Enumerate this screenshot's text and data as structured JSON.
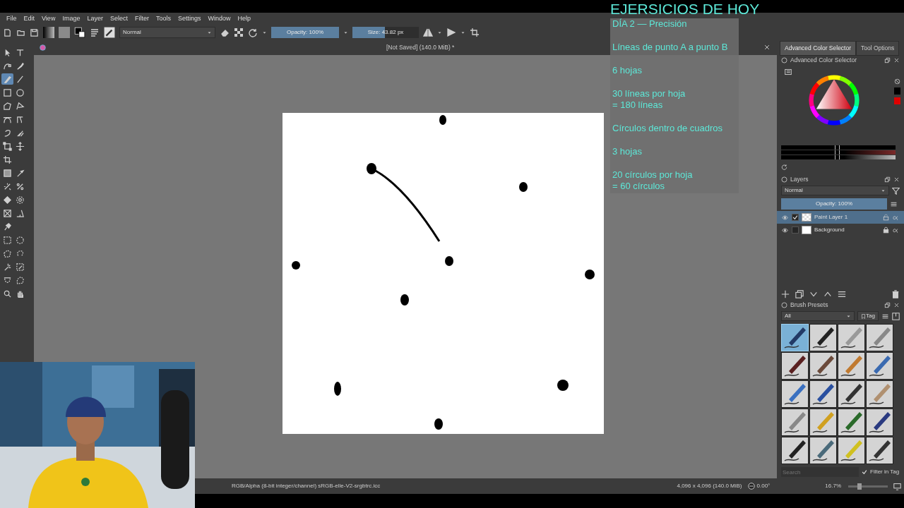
{
  "menu": [
    "File",
    "Edit",
    "View",
    "Image",
    "Layer",
    "Select",
    "Filter",
    "Tools",
    "Settings",
    "Window",
    "Help"
  ],
  "toolbar": {
    "blend_mode": "Normal",
    "opacity": {
      "label": "Opacity: 100%",
      "level": 1
    },
    "size": {
      "label": "Size: 43.82 px",
      "level": 0.49
    }
  },
  "tools": [
    {
      "selected": false
    },
    {
      "selected": false
    },
    {
      "selected": false
    },
    {
      "selected": false
    },
    {
      "selected": true
    },
    {
      "selected": false
    },
    {
      "selected": false
    },
    {
      "selected": false
    },
    {
      "selected": false
    },
    {
      "selected": false
    },
    {
      "selected": false
    },
    {
      "selected": false
    },
    {
      "selected": false
    },
    {
      "selected": false
    },
    {
      "selected": false
    },
    {
      "selected": false
    },
    {
      "selected": false
    },
    {
      "selected": false
    },
    {
      "selected": false
    },
    {
      "selected": false
    },
    {
      "selected": false
    },
    {
      "selected": false
    },
    {
      "selected": false
    },
    {
      "selected": false
    },
    {
      "selected": false
    },
    {
      "selected": false
    },
    {
      "selected": false
    },
    {
      "selected": false
    },
    {
      "selected": false
    },
    {
      "selected": false
    },
    {
      "selected": false
    },
    {
      "selected": false
    },
    {
      "selected": false
    },
    {
      "selected": false
    },
    {
      "selected": false
    },
    {
      "selected": false
    }
  ],
  "document": {
    "title": "[Not Saved]  (140.0 MiB) *"
  },
  "overlay": {
    "heading": "EJERSICIOS DE HOY",
    "groups": [
      {
        "lines": [
          "DÍA 2 — Precisión"
        ]
      },
      {
        "lines": [
          "Líneas de punto A a punto B"
        ]
      },
      {
        "lines": [
          "6 hojas"
        ]
      },
      {
        "lines": [
          "30 líneas por hoja",
          "= 180 líneas"
        ]
      },
      {
        "lines": [
          "Círculos dentro de cuadros"
        ]
      },
      {
        "lines": [
          "3 hojas"
        ]
      },
      {
        "lines": [
          "20 círculos por hoja",
          "= 60 círculos"
        ]
      }
    ]
  },
  "dockers": {
    "tabs": [
      {
        "label": "Advanced Color Selector",
        "selected": true
      },
      {
        "label": "Tool Options",
        "selected": false
      }
    ],
    "color_selector": {
      "title": "Advanced Color Selector",
      "sliders": [
        {
          "level": 0.49
        },
        {
          "level": 0.49
        },
        {
          "level": 0.49
        }
      ],
      "history": [
        {
          "color": "#000000"
        },
        {
          "color": "#e00000"
        }
      ]
    },
    "layers": {
      "title": "Layers",
      "blend_mode": "Normal",
      "opacity": {
        "label": "Opacity:  100%",
        "level": 1
      },
      "items": [
        {
          "name": "Paint Layer 1",
          "selected": true,
          "checked": true,
          "locked": false
        },
        {
          "name": "Background",
          "selected": false,
          "checked": false,
          "locked": true
        }
      ]
    },
    "brush_presets": {
      "title": "Brush Presets",
      "filter": "All",
      "tag_button": "Tag",
      "search_placeholder": "Search",
      "filter_in_tag": {
        "label": "Filter in Tag",
        "checked": true
      },
      "presets": [
        {
          "selected": true
        },
        {
          "selected": false
        },
        {
          "selected": false
        },
        {
          "selected": false
        },
        {
          "selected": false
        },
        {
          "selected": false
        },
        {
          "selected": false
        },
        {
          "selected": false
        },
        {
          "selected": false
        },
        {
          "selected": false
        },
        {
          "selected": false
        },
        {
          "selected": false
        },
        {
          "selected": false
        },
        {
          "selected": false
        },
        {
          "selected": false
        },
        {
          "selected": false
        },
        {
          "selected": false
        },
        {
          "selected": false
        },
        {
          "selected": false
        },
        {
          "selected": false
        }
      ]
    }
  },
  "status_bar": {
    "color_space": "RGB/Alpha (8-bit integer/channel)  sRGB-elle-V2-srgbtrc.icc",
    "image_size": "4,096 x 4,096 (140.0 MiB)",
    "rotation": "0.00°",
    "zoom": "16.7%",
    "zoom_slider": {
      "level": 0.25
    }
  }
}
